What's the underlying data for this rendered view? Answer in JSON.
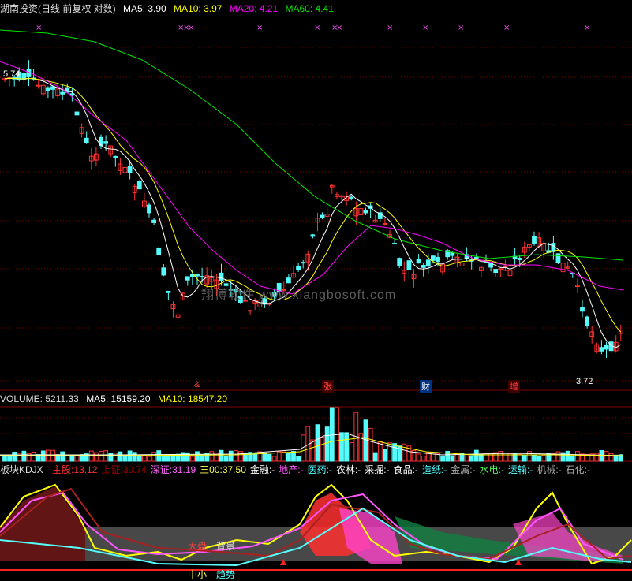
{
  "price_header": {
    "stock": "湖南投资(日线 前复权 对数)",
    "ma5": "MA5: 3.90",
    "ma10": "MA10: 3.97",
    "ma20": "MA20: 4.21",
    "ma60": "MA60: 4.41"
  },
  "price_labels": {
    "high": "5.74",
    "low": "3.72"
  },
  "event_markers": [
    "&",
    "张",
    "财",
    "增"
  ],
  "volume_header": {
    "volume": "VOLUME: 5211.33",
    "ma5": "MA5: 15159.20",
    "ma10": "MA10: 18547.20"
  },
  "kdj_header": {
    "title": "板块KDJX",
    "items": [
      {
        "label": "主股:",
        "value": "13.12",
        "color": "#ff3030"
      },
      {
        "label": "上证:",
        "value": "30.74",
        "color": "#a00000"
      },
      {
        "label": "深证:",
        "value": "31.19",
        "color": "#ff66ff"
      },
      {
        "label": "三00:",
        "value": "37.50",
        "color": "#ffff55"
      },
      {
        "label": "金融:",
        "value": "-",
        "color": "#ffffff"
      },
      {
        "label": "地产:",
        "value": "-",
        "color": "#ff55ff"
      },
      {
        "label": "医药:",
        "value": "-",
        "color": "#55ffff"
      },
      {
        "label": "农林:",
        "value": "-",
        "color": "#ffffff"
      },
      {
        "label": "采掘:",
        "value": "-",
        "color": "#ffffff"
      },
      {
        "label": "食品:",
        "value": "-",
        "color": "#ffffff"
      },
      {
        "label": "造纸:",
        "value": "-",
        "color": "#55ffff"
      },
      {
        "label": "金属:",
        "value": "-",
        "color": "#aaaaaa"
      },
      {
        "label": "水电:",
        "value": "-",
        "color": "#55ff55"
      },
      {
        "label": "运输:",
        "value": "-",
        "color": "#55ffff"
      },
      {
        "label": "机械:",
        "value": "-",
        "color": "#aaaaaa"
      },
      {
        "label": "石化:",
        "value": "-",
        "color": "#aaaaaa"
      }
    ]
  },
  "kdj_legend": {
    "dapan": "大盘",
    "beijing": "背景",
    "zhongxiao": "中小",
    "qiangshi": "趋势"
  },
  "watermark": "翔博软件 www.xiangbosoft.com",
  "colors": {
    "bg": "#000000",
    "up": "#ff3232",
    "down": "#54fcfc",
    "ma5": "#ffffff",
    "ma10": "#ffff00",
    "ma20": "#ff00ff",
    "ma60": "#00e600",
    "grid": "#800000",
    "header_label": "#c0c0c0"
  }
}
